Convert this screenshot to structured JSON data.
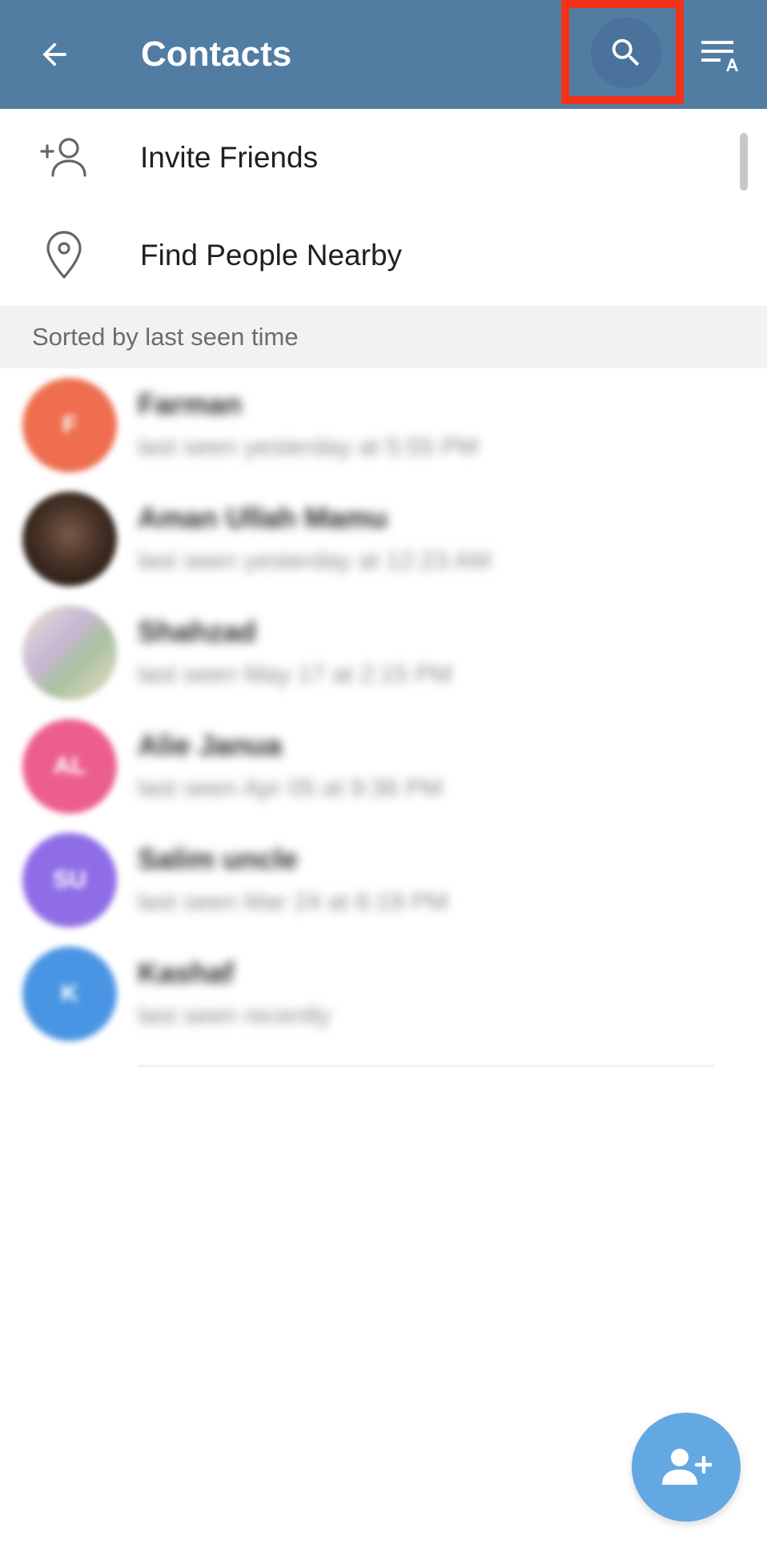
{
  "header": {
    "title": "Contacts",
    "back_icon": "arrow-left-icon",
    "search_icon": "search-icon",
    "sort_icon": "sort-alphabet-icon",
    "bar_color": "#527da3",
    "highlight_color": "#f2321a"
  },
  "menu": [
    {
      "label": "Invite Friends",
      "icon": "add-person-icon"
    },
    {
      "label": "Find People Nearby",
      "icon": "location-pin-icon"
    }
  ],
  "section": {
    "title": "Sorted by last seen time"
  },
  "contacts": [
    {
      "name": "Farman",
      "status": "last seen yesterday at 5:55 PM",
      "initials": "F",
      "color": "#ee6e4f"
    },
    {
      "name": "Aman Ullah Mamu",
      "status": "last seen yesterday at 12:23 AM",
      "initials": "",
      "color": "#3a2a22"
    },
    {
      "name": "Shahzad",
      "status": "last seen May 17 at 2:15 PM",
      "initials": "",
      "color": "#e8dcc4"
    },
    {
      "name": "Alie Janua",
      "status": "last seen Apr 05 at 9:36 PM",
      "initials": "AL",
      "color": "#ec5f8d"
    },
    {
      "name": "Salim uncle",
      "status": "last seen Mar 24 at 6:19 PM",
      "initials": "SU",
      "color": "#8f6de6"
    },
    {
      "name": "Kashaf",
      "status": "last seen recently",
      "initials": "K",
      "color": "#4a95e3"
    }
  ],
  "fab": {
    "icon": "add-contact-icon",
    "color": "#63a8e2"
  }
}
